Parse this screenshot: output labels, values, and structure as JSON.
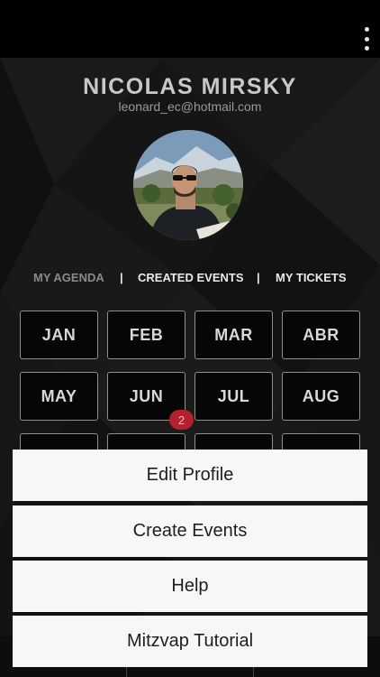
{
  "profile": {
    "name": "NICOLAS MIRSKY",
    "email": "leonard_ec@hotmail.com"
  },
  "tabs": [
    {
      "label": "MY AGENDA",
      "active": true
    },
    {
      "label": "CREATED EVENTS",
      "active": false
    },
    {
      "label": "MY TICKETS",
      "active": false
    }
  ],
  "tab_separator": "|",
  "months": [
    "JAN",
    "FEB",
    "MAR",
    "ABR",
    "MAY",
    "JUN",
    "JUL",
    "AUG"
  ],
  "badge": {
    "month": "JUN",
    "count": "2",
    "color": "#b4202d"
  },
  "menu": {
    "items": [
      "Edit Profile",
      "Create Events",
      "Help",
      "Mitzvap Tutorial"
    ]
  },
  "icons": {
    "overflow": "more-vert-icon"
  }
}
